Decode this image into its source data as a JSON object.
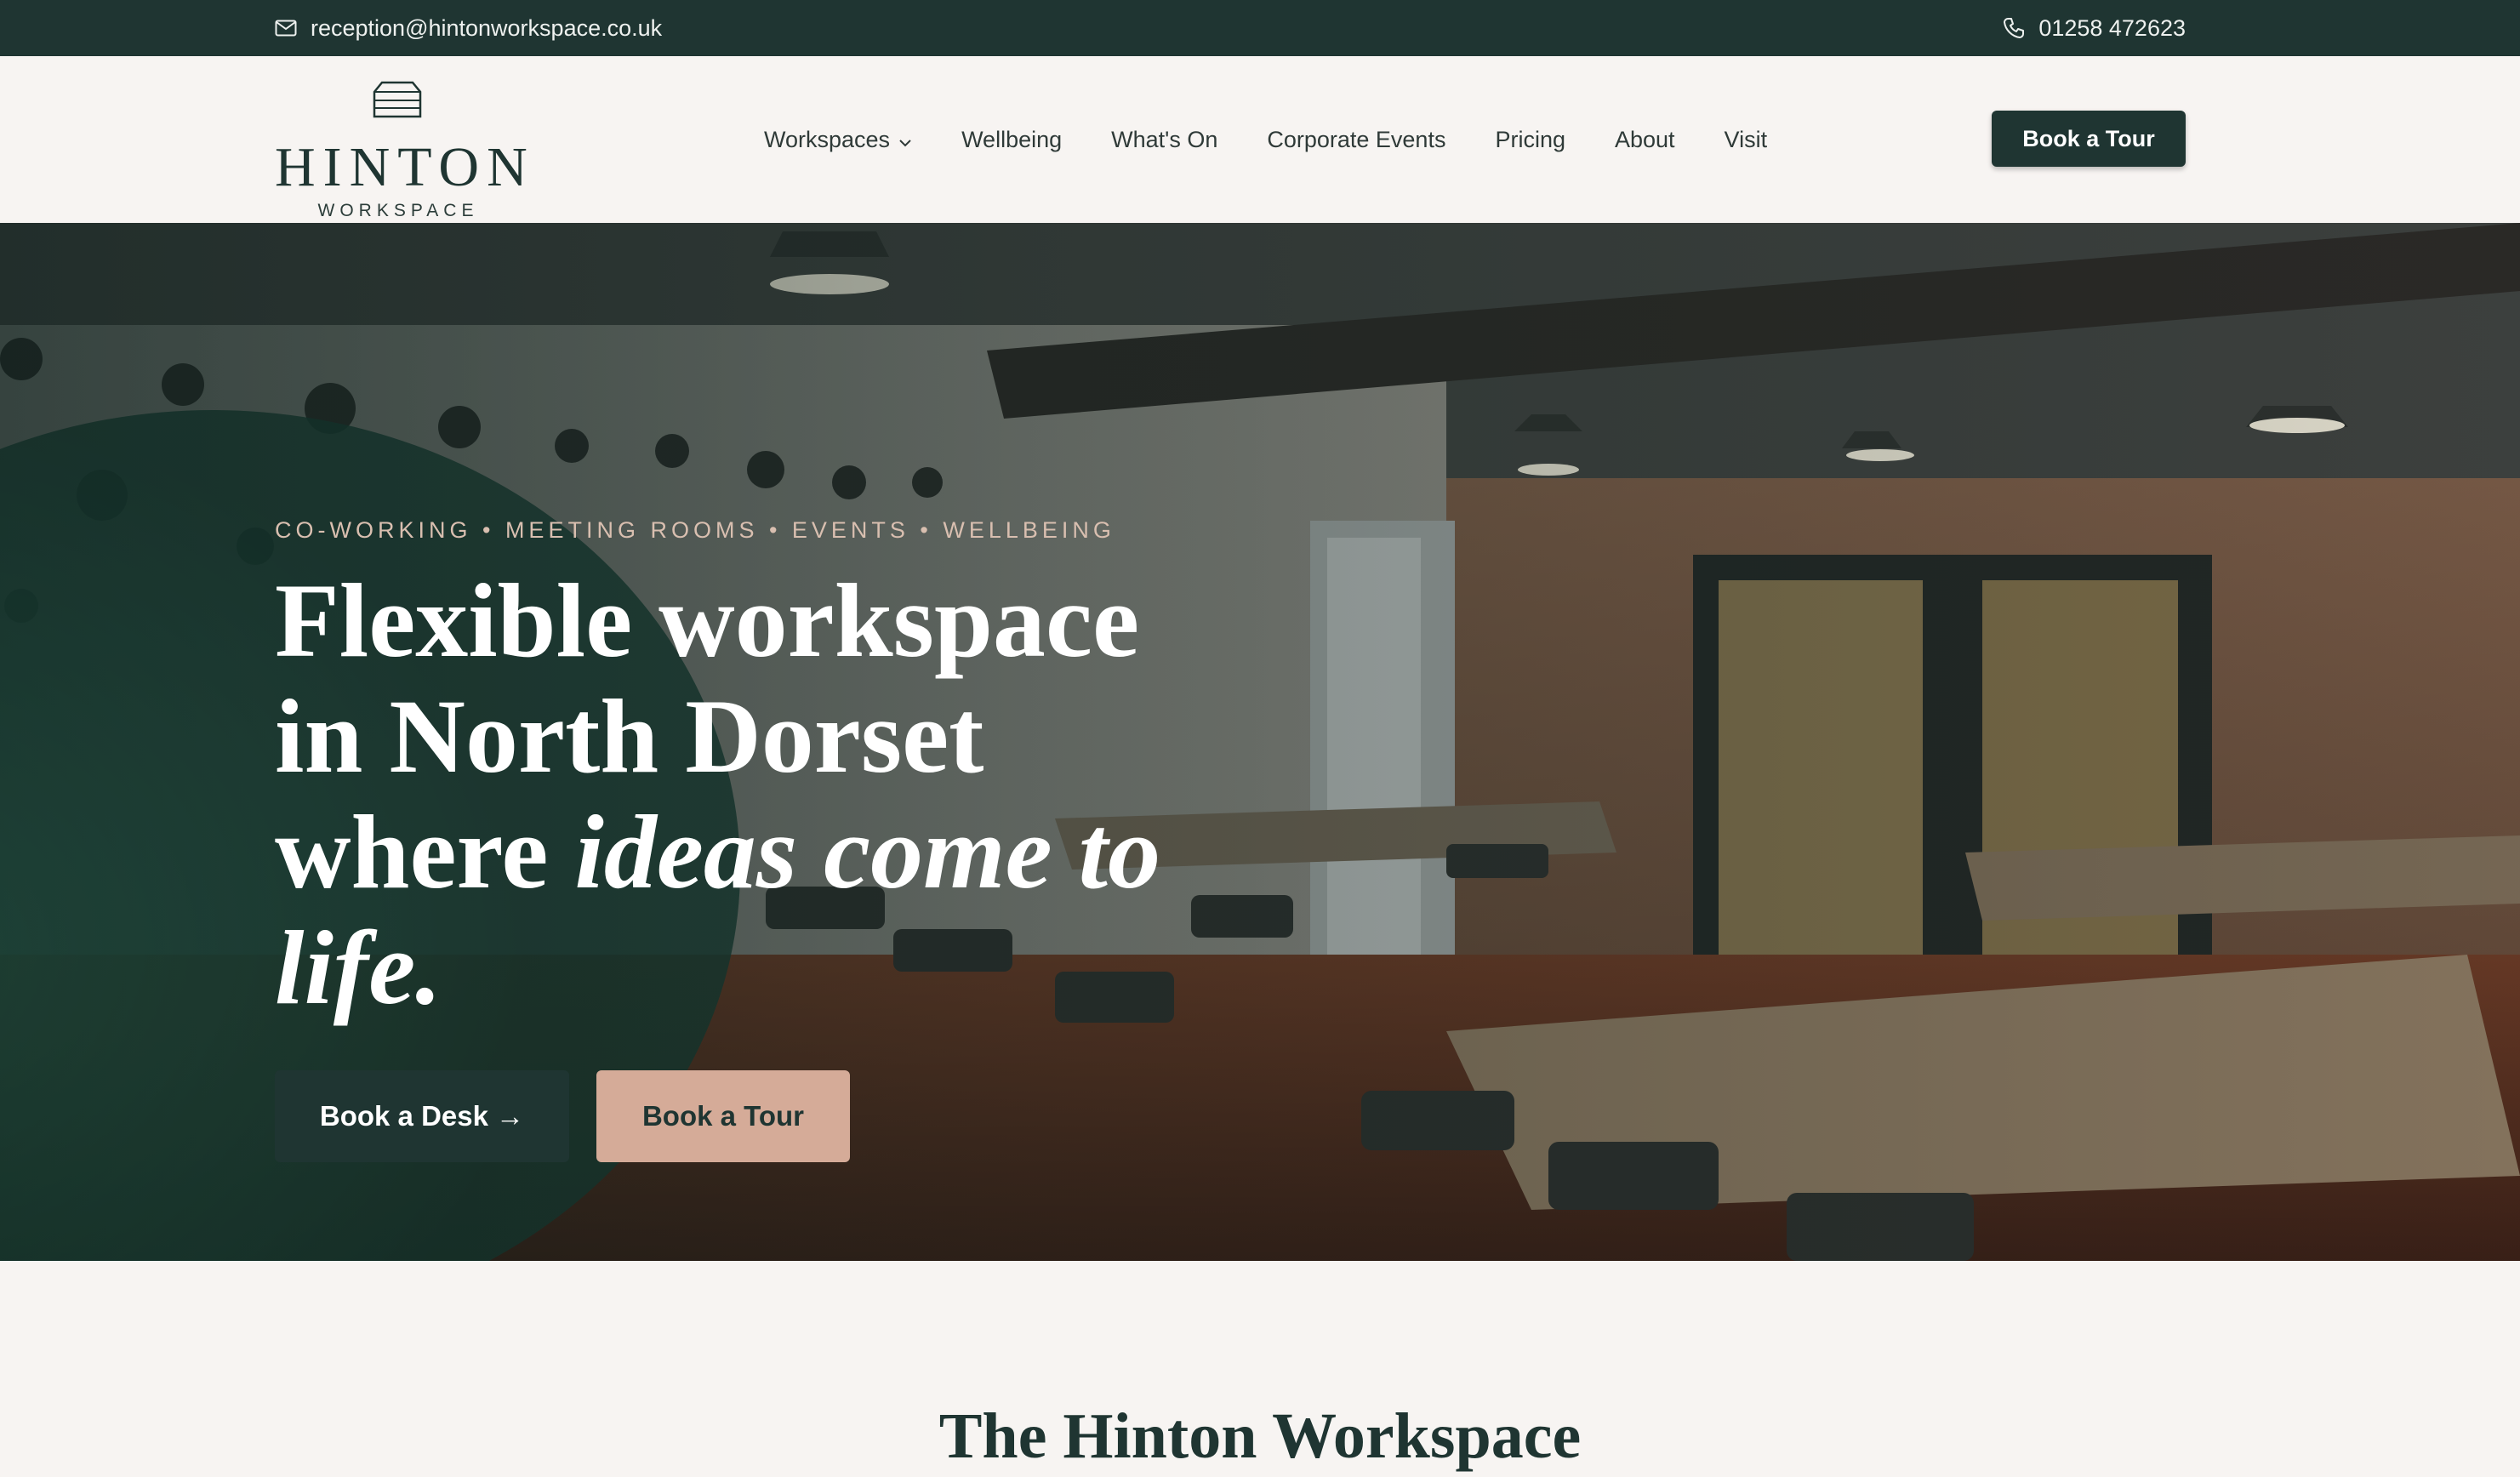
{
  "topbar": {
    "email": "reception@hintonworkspace.co.uk",
    "email_icon": "mail-icon",
    "phone": "01258 472623",
    "phone_icon": "phone-icon"
  },
  "logo": {
    "name": "HINTON",
    "sub": "WORKSPACE"
  },
  "nav": {
    "items": [
      {
        "label": "Workspaces",
        "has_dropdown": true
      },
      {
        "label": "Wellbeing"
      },
      {
        "label": "What's On"
      },
      {
        "label": "Corporate Events"
      },
      {
        "label": "Pricing"
      },
      {
        "label": "About"
      },
      {
        "label": "Visit"
      }
    ],
    "cta": "Book a Tour"
  },
  "hero": {
    "eyebrow": "CO-WORKING • MEETING ROOMS • EVENTS • WELLBEING",
    "headline_line1": "Flexible workspace",
    "headline_line2": "in North Dorset",
    "headline_line3_plain": "where ",
    "headline_line3_italic": "ideas come to",
    "headline_line4_italic": "life.",
    "btn_primary": "Book a Desk →",
    "btn_secondary": "Book a Tour"
  },
  "intro": {
    "title": "The Hinton Workspace"
  },
  "colors": {
    "brand_dark": "#1f3532",
    "accent_blush": "#d5ab98",
    "page_bg": "#f7f4f2"
  }
}
